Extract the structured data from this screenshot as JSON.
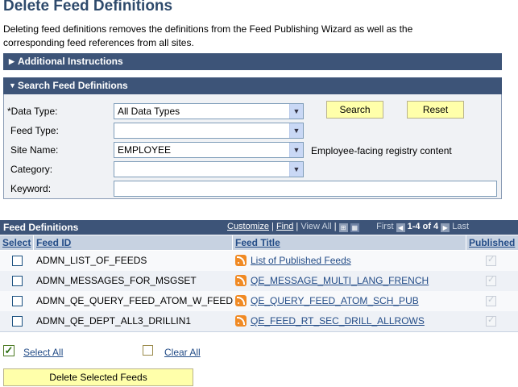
{
  "page": {
    "title": "Delete Feed Definitions",
    "description": "Deleting feed definitions removes the definitions from the Feed Publishing Wizard as well as the corresponding feed references from all sites."
  },
  "additional_instructions": {
    "label": "Additional Instructions"
  },
  "search": {
    "section_label": "Search Feed Definitions",
    "data_type": {
      "label": "*Data Type:",
      "value": "All Data Types"
    },
    "feed_type": {
      "label": "Feed Type:",
      "value": ""
    },
    "site_name": {
      "label": "Site Name:",
      "value": "EMPLOYEE",
      "description": "Employee-facing registry content"
    },
    "category": {
      "label": "Category:",
      "value": ""
    },
    "keyword": {
      "label": "Keyword:",
      "value": ""
    },
    "search_label": "Search",
    "reset_label": "Reset"
  },
  "grid": {
    "title": "Feed Definitions",
    "customize": "Customize",
    "sep1": "|",
    "find": "Find",
    "sep2": "|",
    "view_all": "View All",
    "sep3": "|",
    "first": "First",
    "range": "1-4 of 4",
    "last": "Last",
    "columns": {
      "select": "Select",
      "feed_id": "Feed ID",
      "feed_title": "Feed Title",
      "published": "Published"
    },
    "rows": [
      {
        "feed_id": "ADMN_LIST_OF_FEEDS",
        "feed_title": "List of Published Feeds",
        "published": true
      },
      {
        "feed_id": "ADMN_MESSAGES_FOR_MSGSET",
        "feed_title": "QE_MESSAGE_MULTI_LANG_FRENCH",
        "published": true
      },
      {
        "feed_id": "ADMN_QE_QUERY_FEED_ATOM_W_FEED",
        "feed_title": "QE_QUERY_FEED_ATOM_SCH_PUB",
        "published": true
      },
      {
        "feed_id": "ADMN_QE_DEPT_ALL3_DRILLIN1",
        "feed_title": "QE_FEED_RT_SEC_DRILL_ALLROWS",
        "published": true
      }
    ]
  },
  "actions": {
    "select_all": "Select All",
    "clear_all": "Clear All",
    "delete_selected": "Delete Selected Feeds"
  },
  "colors": {
    "header_bar": "#3d5478",
    "button_yellow": "#ffffaa",
    "link": "#234c87"
  },
  "icons": [
    "triangle-right-icon",
    "triangle-down-icon",
    "chevron-down-icon",
    "rss-icon",
    "find-icon",
    "grid-icon",
    "first-arrow-icon",
    "last-arrow-icon",
    "checkbox-checked-icon",
    "checkbox-empty-icon"
  ]
}
